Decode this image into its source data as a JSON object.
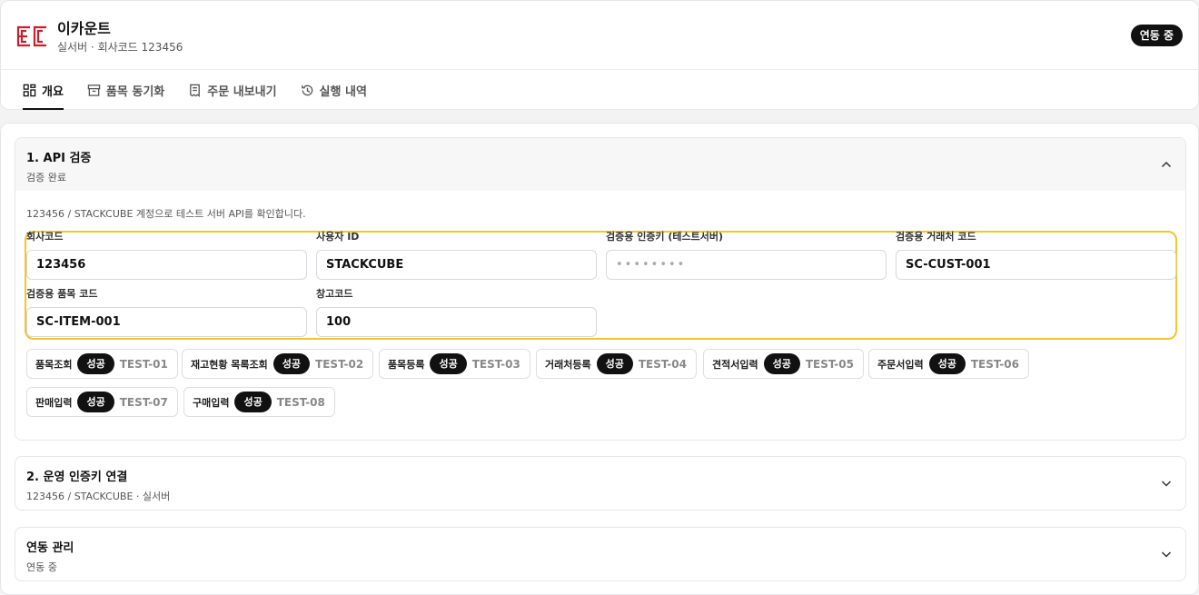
{
  "app": {
    "title": "이카운트",
    "subtitle": "실서버 · 회사코드 123456",
    "status_badge": "연동 중",
    "brand_color": "#c8202f"
  },
  "tabs": [
    {
      "label": "개요",
      "icon": "grid-icon",
      "active": true
    },
    {
      "label": "품목 동기화",
      "icon": "archive-icon",
      "active": false
    },
    {
      "label": "주문 내보내기",
      "icon": "receipt-icon",
      "active": false
    },
    {
      "label": "실행 내역",
      "icon": "history-icon",
      "active": false
    }
  ],
  "section1": {
    "title": "1. API 검증",
    "subtitle": "검증 완료",
    "description": "123456 / STACKCUBE 계정으로 테스트 서버 API를 확인합니다.",
    "highlight_color": "#f2c62e",
    "fields": [
      {
        "label": "회사코드",
        "value": "123456"
      },
      {
        "label": "사용자 ID",
        "value": "STACKCUBE"
      },
      {
        "label": "검증용 인증키 (테스트서버)",
        "value": "••••••••"
      },
      {
        "label": "검증용 거래처 코드",
        "value": "SC-CUST-001"
      },
      {
        "label": "검증용 품목 코드",
        "value": "SC-ITEM-001"
      },
      {
        "label": "창고코드",
        "value": "100"
      }
    ],
    "tests": [
      {
        "name": "품목조회",
        "status": "성공",
        "code": "TEST-01"
      },
      {
        "name": "재고현황 목록조회",
        "status": "성공",
        "code": "TEST-02"
      },
      {
        "name": "품목등록",
        "status": "성공",
        "code": "TEST-03"
      },
      {
        "name": "거래처등록",
        "status": "성공",
        "code": "TEST-04"
      },
      {
        "name": "견적서입력",
        "status": "성공",
        "code": "TEST-05"
      },
      {
        "name": "주문서입력",
        "status": "성공",
        "code": "TEST-06"
      },
      {
        "name": "판매입력",
        "status": "성공",
        "code": "TEST-07"
      },
      {
        "name": "구매입력",
        "status": "성공",
        "code": "TEST-08"
      }
    ]
  },
  "section2": {
    "title": "2. 운영 인증키 연결",
    "subtitle": "123456 / STACKCUBE · 실서버"
  },
  "section3": {
    "title": "연동 관리",
    "subtitle": "연동 중"
  }
}
